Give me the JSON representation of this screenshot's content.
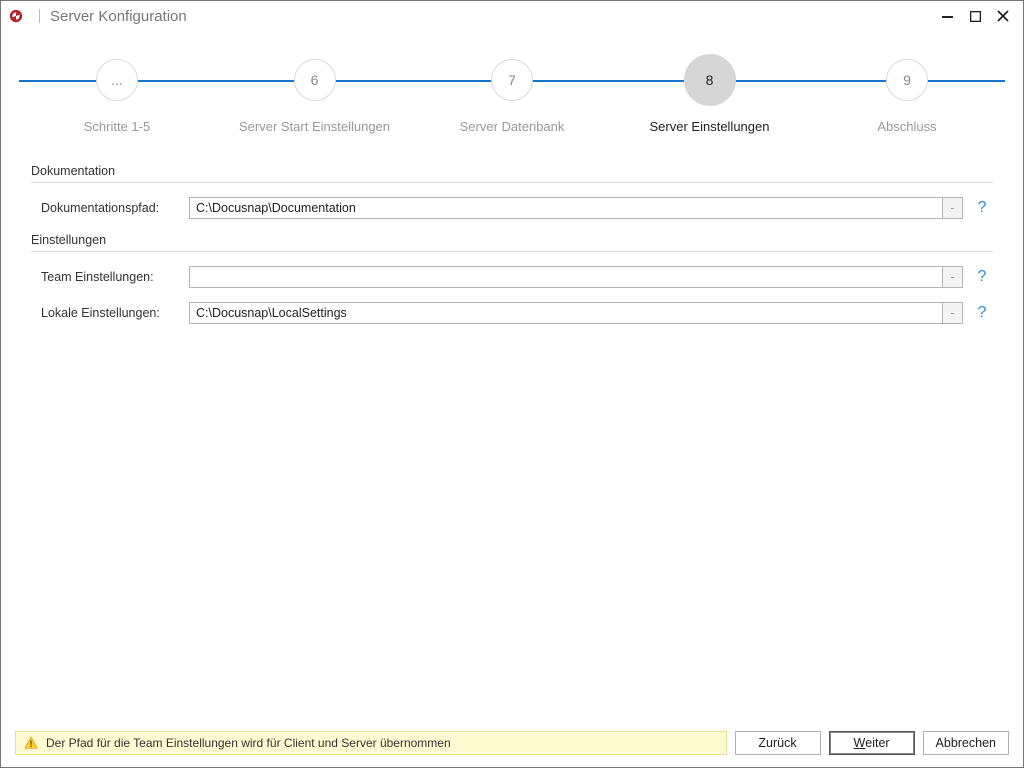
{
  "window": {
    "title": "Server Konfiguration"
  },
  "stepper": {
    "steps": [
      {
        "num": "...",
        "label": "Schritte 1-5"
      },
      {
        "num": "6",
        "label": "Server Start Einstellungen"
      },
      {
        "num": "7",
        "label": "Server Datenbank"
      },
      {
        "num": "8",
        "label": "Server Einstellungen"
      },
      {
        "num": "9",
        "label": "Abschluss"
      }
    ],
    "active_index": 3
  },
  "sections": {
    "doc": {
      "title": "Dokumentation",
      "path_label": "Dokumentationspfad:",
      "path_value": "C:\\Docusnap\\Documentation"
    },
    "settings": {
      "title": "Einstellungen",
      "team_label": "Team Einstellungen:",
      "team_value": "",
      "local_label": "Lokale Einstellungen:",
      "local_value": "C:\\Docusnap\\LocalSettings"
    }
  },
  "footer": {
    "warning": "Der Pfad für die Team Einstellungen wird für Client und Server übernommen",
    "back": "Zurück",
    "next_underline_first": "W",
    "next_rest": "eiter",
    "cancel": "Abbrechen"
  },
  "icons": {
    "browse": "...",
    "help": "?"
  }
}
